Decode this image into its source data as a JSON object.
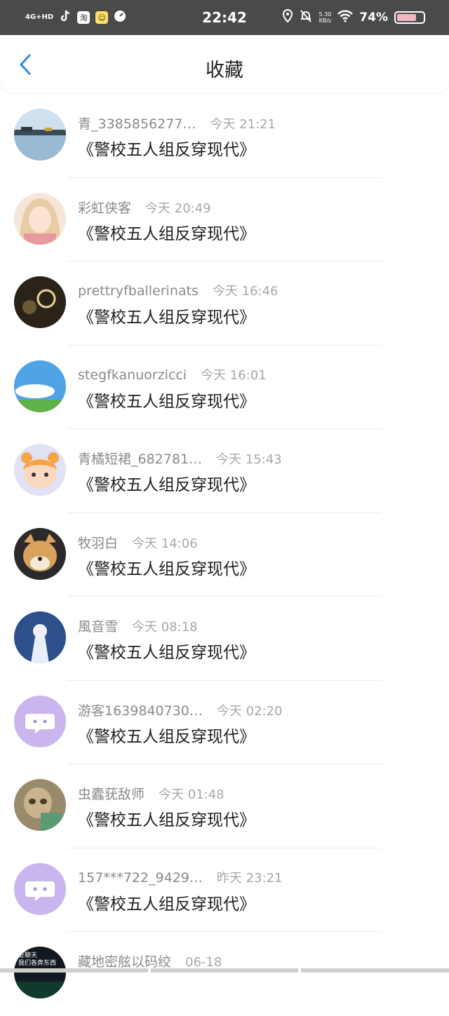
{
  "status_bar": {
    "signal": "4G+HD",
    "app_icons": [
      "tiktok-icon",
      "taobao-icon",
      "emoji-app-icon",
      "speed-icon"
    ],
    "taobao_label": "淘",
    "time": "22:42",
    "net_speed": "5.30\nKB/s",
    "battery": "74%",
    "battery_level": 0.74
  },
  "header": {
    "title": "收藏",
    "back_color": "#2b8be6"
  },
  "items": [
    {
      "user": "青_3385856277…",
      "time": "今天 21:21",
      "book": "《警校五人组反穿现代》",
      "avatar": "lake"
    },
    {
      "user": "彩虹侠客",
      "time": "今天 20:49",
      "book": "《警校五人组反穿现代》",
      "avatar": "anime-girl"
    },
    {
      "user": "prettryfballerinats",
      "time": "今天 16:46",
      "book": "《警校五人组反穿现代》",
      "avatar": "dark-light"
    },
    {
      "user": "stegfkanuorzicci",
      "time": "今天 16:01",
      "book": "《警校五人组反穿现代》",
      "avatar": "sky"
    },
    {
      "user": "青橘短裙_682781…",
      "time": "今天 15:43",
      "book": "《警校五人组反穿现代》",
      "avatar": "cartoon-bear"
    },
    {
      "user": "牧羽白",
      "time": "今天 14:06",
      "book": "《警校五人组反穿现代》",
      "avatar": "shiba-dog"
    },
    {
      "user": "風音雪",
      "time": "今天 08:18",
      "book": "《警校五人组反穿现代》",
      "avatar": "snow-girl"
    },
    {
      "user": "游客1639840730…",
      "time": "今天 02:20",
      "book": "《警校五人组反穿现代》",
      "avatar": "default-chat"
    },
    {
      "user": "虫蠹莸敌师",
      "time": "今天 01:48",
      "book": "《警校五人组反穿现代》",
      "avatar": "sloth"
    },
    {
      "user": "157***722_9429…",
      "time": "昨天 23:21",
      "book": "《警校五人组反穿现代》",
      "avatar": "default-chat"
    },
    {
      "user": "藏地密舷以码绞",
      "time": "06-18",
      "book": "",
      "avatar": "text-dark"
    }
  ],
  "partial_avatar_text": [
    "业聊天",
    "我们各奔东西"
  ]
}
